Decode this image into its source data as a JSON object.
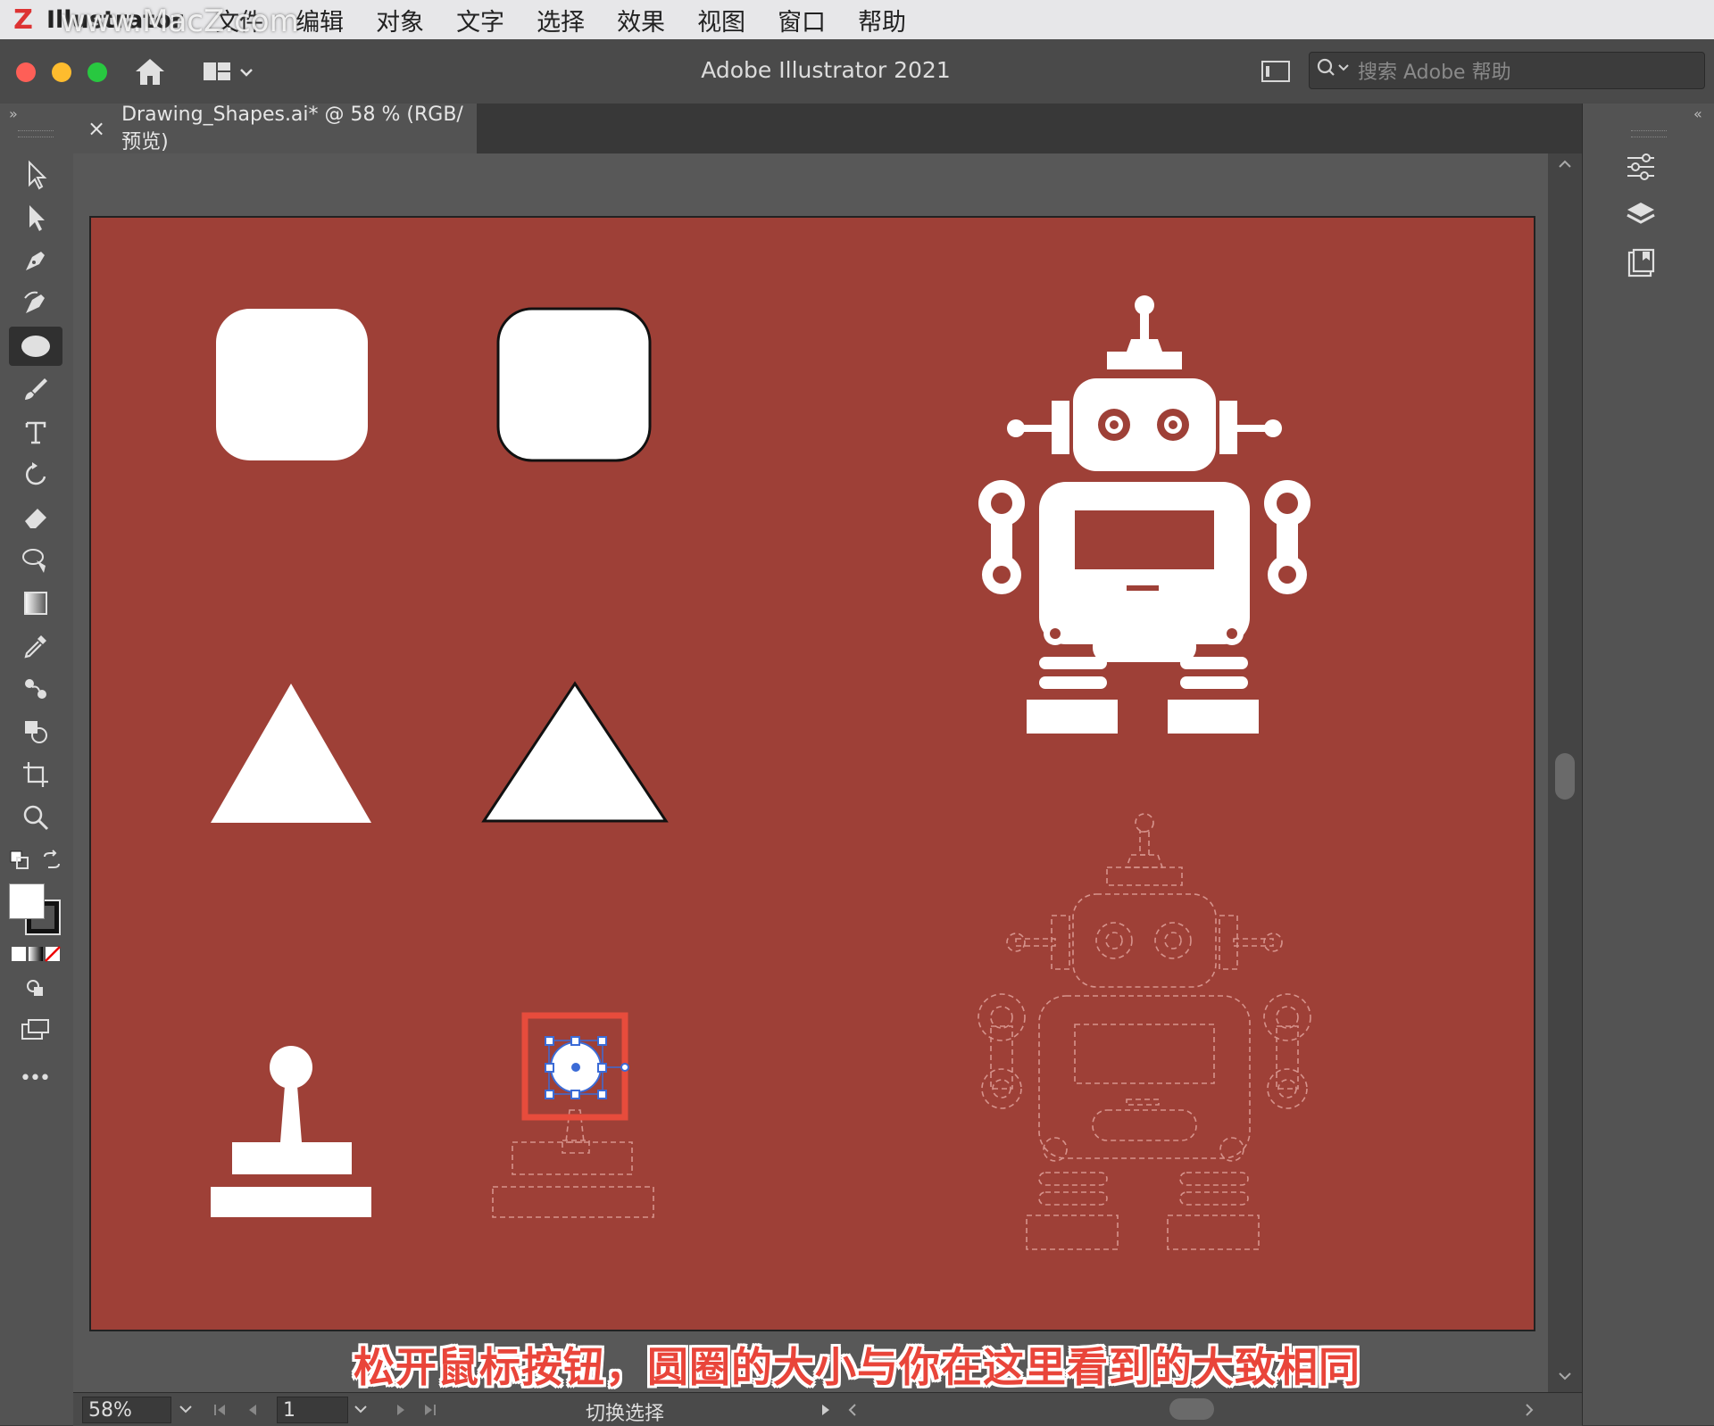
{
  "menubar": {
    "app_name": "Illustrator",
    "items": [
      "文件",
      "编辑",
      "对象",
      "文字",
      "选择",
      "效果",
      "视图",
      "窗口",
      "帮助"
    ],
    "watermark": "www.MacZ.com"
  },
  "window": {
    "title": "Adobe Illustrator 2021",
    "search_placeholder": "搜索 Adobe 帮助"
  },
  "document_tab": {
    "close": "×",
    "label": "Drawing_Shapes.ai* @ 58 % (RGB/预览)"
  },
  "toolbar": {
    "tools": [
      "selection-tool-icon",
      "direct-selection-tool-icon",
      "pen-tool-icon",
      "curvature-tool-icon",
      "ellipse-tool-icon",
      "paintbrush-tool-icon",
      "type-tool-icon",
      "rotate-tool-icon",
      "eraser-tool-icon",
      "lasso-tool-icon",
      "gradient-tool-icon",
      "eyedropper-tool-icon",
      "blend-tool-icon",
      "shape-builder-tool-icon",
      "artboard-tool-icon",
      "zoom-tool-icon"
    ],
    "more": "•••"
  },
  "right_panel": {
    "buttons": [
      "properties-panel-icon",
      "layers-panel-icon",
      "libraries-panel-icon"
    ]
  },
  "canvas": {
    "artboard_color": "#9e4037",
    "shape_color": "#ffffff",
    "selection_color": "#3b6bd6",
    "highlight_color": "#e74c3c"
  },
  "caption": "松开鼠标按钮，圆圈的大小与你在这里看到的大致相同",
  "statusbar": {
    "zoom": "58%",
    "page": "1",
    "label": "切换选择"
  }
}
